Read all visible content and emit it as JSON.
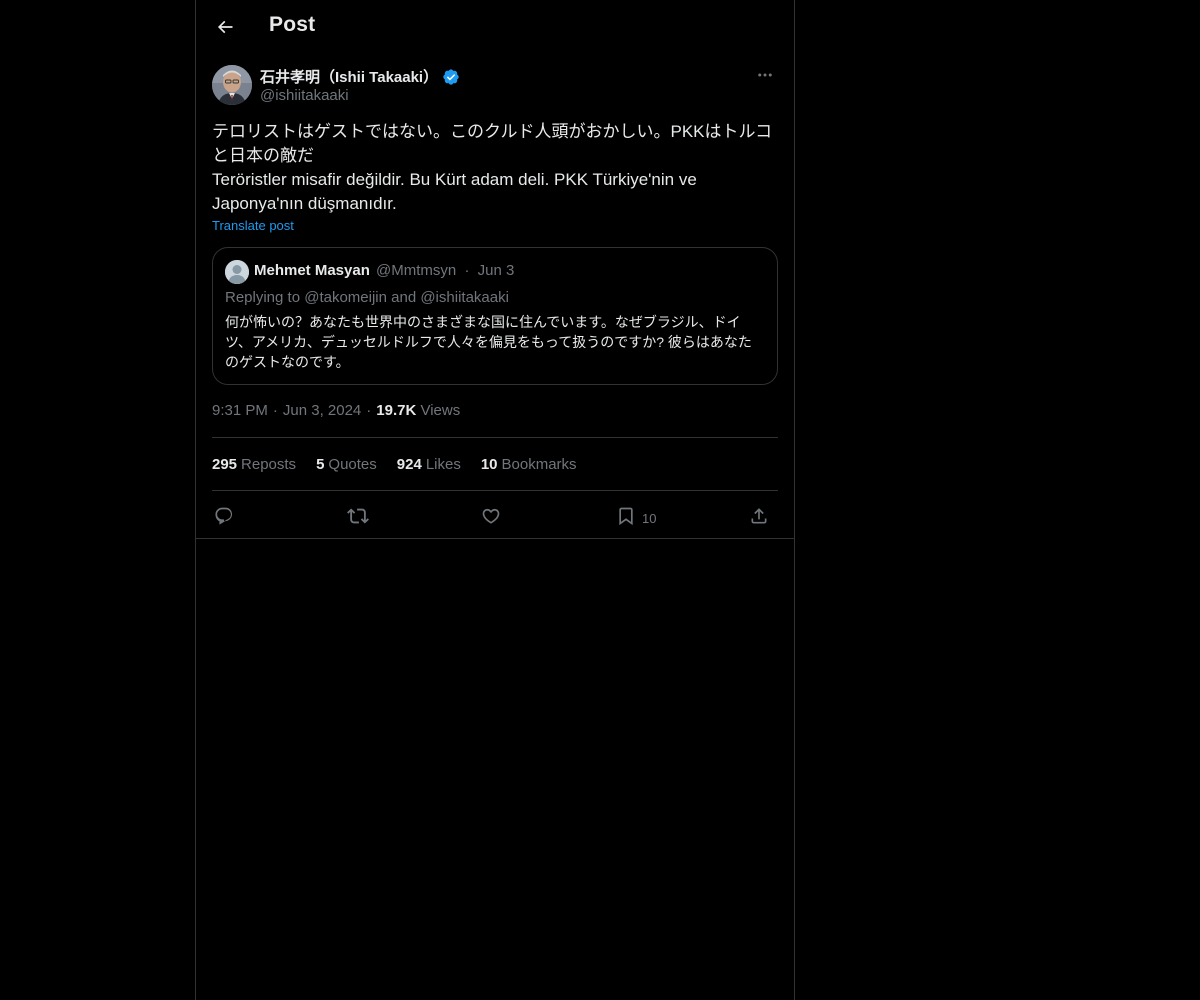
{
  "header": {
    "title": "Post"
  },
  "post": {
    "author_name": "石井孝明（Ishii Takaaki）",
    "author_handle": "@ishiitakaaki",
    "text_line1": "テロリストはゲストではない。このクルド人頭がおかしい。PKKはトルコと日本の敵だ",
    "text_line2": "Teröristler misafir değildir. Bu Kürt adam deli. PKK Türkiye'nin ve Japonya'nın düşmanıdır.",
    "translate_label": "Translate post",
    "time": "9:31 PM",
    "date": "Jun 3, 2024",
    "views_count": "19.7K",
    "views_label": "Views"
  },
  "quote": {
    "author_name": "Mehmet Masyan",
    "author_handle": "@Mmtmsyn",
    "date": "Jun 3",
    "replying_to": "Replying to @takomeijin and @ishiitakaaki",
    "text": "何が怖いの？あなたも世界中のさまざまな国に住んでいます。なぜブラジル、ドイツ、アメリカ、デュッセルドルフで人々を偏見をもって扱うのですか? 彼らはあなたのゲストなのです。"
  },
  "stats": [
    {
      "count": "295",
      "label": "Reposts"
    },
    {
      "count": "5",
      "label": "Quotes"
    },
    {
      "count": "924",
      "label": "Likes"
    },
    {
      "count": "10",
      "label": "Bookmarks"
    }
  ],
  "actions": {
    "bookmark_count": "10"
  },
  "dot_separator": "·",
  "colors": {
    "background": "#000000",
    "text": "#e7e9ea",
    "secondary": "#71767b",
    "accent": "#1d9bf0",
    "border": "#2f3336"
  },
  "icons": [
    "arrow-left-icon",
    "verified-badge-icon",
    "more-icon",
    "reply-icon",
    "repost-icon",
    "like-icon",
    "bookmark-icon",
    "share-icon"
  ]
}
